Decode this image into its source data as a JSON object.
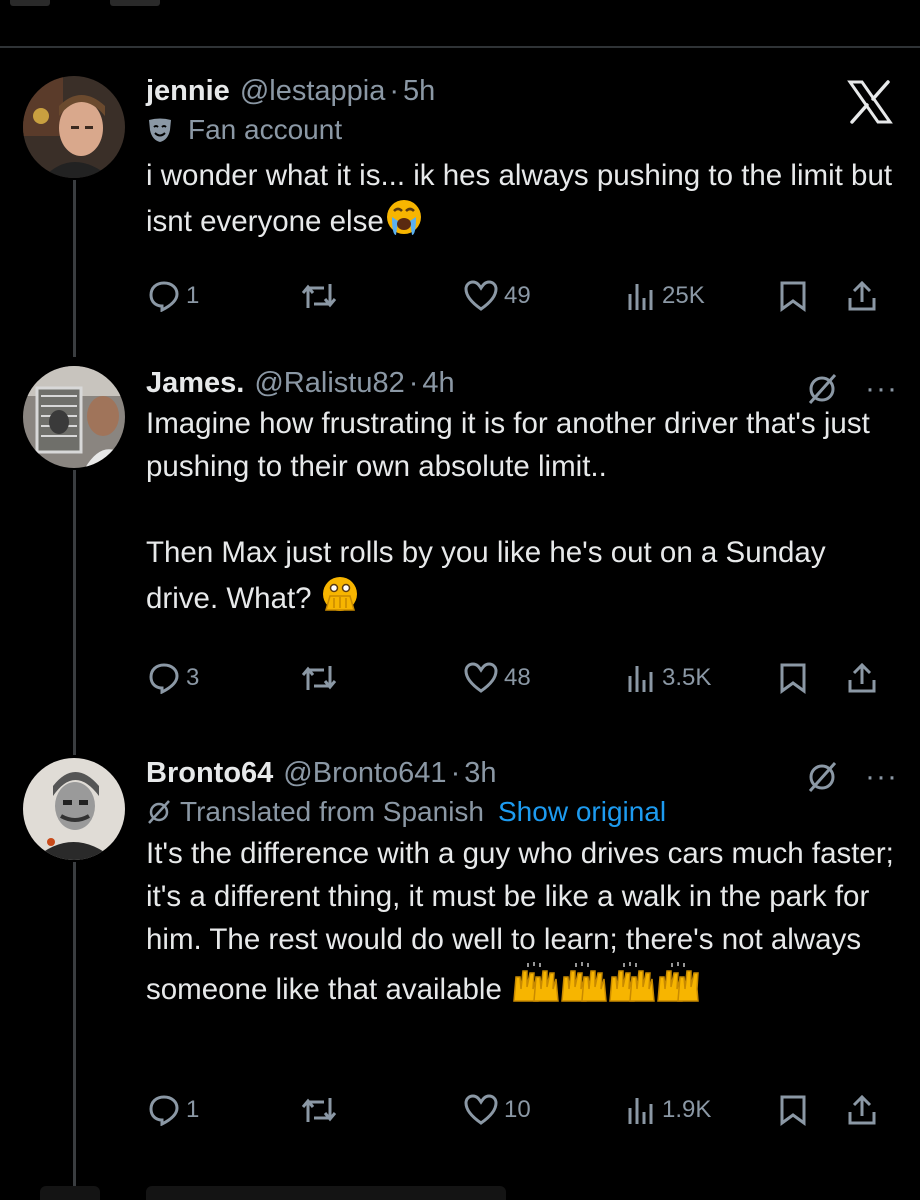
{
  "tweets": [
    {
      "name": "jennie",
      "handle": "@lestappia",
      "time": "5h",
      "badge_text": "Fan account",
      "text": "i wonder what it is... ik hes always pushing to the limit but isnt everyone else",
      "emoji": "loudly-crying-face",
      "replies": "1",
      "reposts": "",
      "likes": "49",
      "views": "25K"
    },
    {
      "name": "James.",
      "handle": "@Ralistu82",
      "time": "4h",
      "text": "Imagine how frustrating it is for another driver that's just pushing to their own absolute limit..\n\nThen Max just rolls by you like he's out on a Sunday drive. What?",
      "emoji": "face-with-open-eyes-and-hand-over-mouth",
      "replies": "3",
      "reposts": "",
      "likes": "48",
      "views": "3.5K"
    },
    {
      "name": "Bronto64",
      "handle": "@Bronto641",
      "time": "3h",
      "translated_text": "Translated from Spanish",
      "show_original": "Show original",
      "text": "It's the difference with a guy who drives cars much faster; it's a different thing, it must be like a walk in the park for him. The rest would do well to learn; there's not always someone like that available",
      "emoji": "raising-hands x4",
      "replies": "1",
      "reposts": "",
      "likes": "10",
      "views": "1.9K"
    }
  ],
  "dot": "·",
  "more": "···",
  "colors": {
    "background": "#000000",
    "text": "#e7e9ea",
    "muted": "#8b98a5",
    "link": "#1d9bf0",
    "emoji_yellow": "#f7b500"
  }
}
